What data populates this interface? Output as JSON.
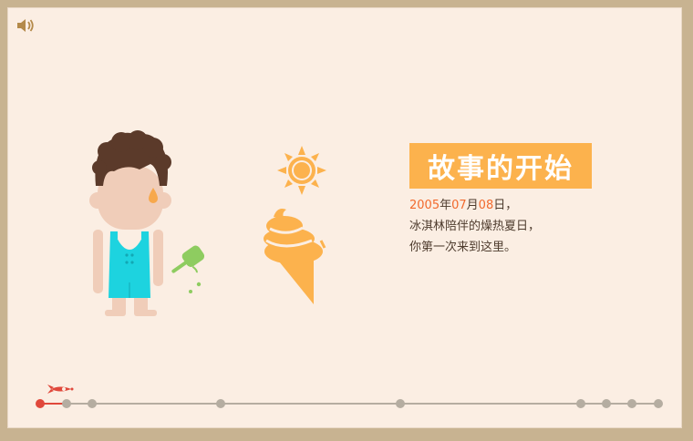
{
  "title": "故事的开始",
  "story": {
    "date_year": "2005",
    "date_sep1": "年",
    "date_month": "07",
    "date_sep2": "月",
    "date_day": "08",
    "date_sep3": "日，",
    "line2": "冰淇林陪伴的燥热夏日，",
    "line3": "你第一次来到这里。"
  },
  "timeline": {
    "stops": 10,
    "current_index": 0
  },
  "colors": {
    "accent_orange": "#fcb24d",
    "date_red": "#f26a2d",
    "timeline_active": "#e0483b",
    "timeline_dot": "#b5ada1",
    "background": "#fbeee3",
    "frame": "#c8b391"
  },
  "icons": {
    "sound": "speaker-icon",
    "current_marker": "rocket-icon",
    "sun": "sun-icon",
    "ice_cream": "ice-cream-icon"
  }
}
